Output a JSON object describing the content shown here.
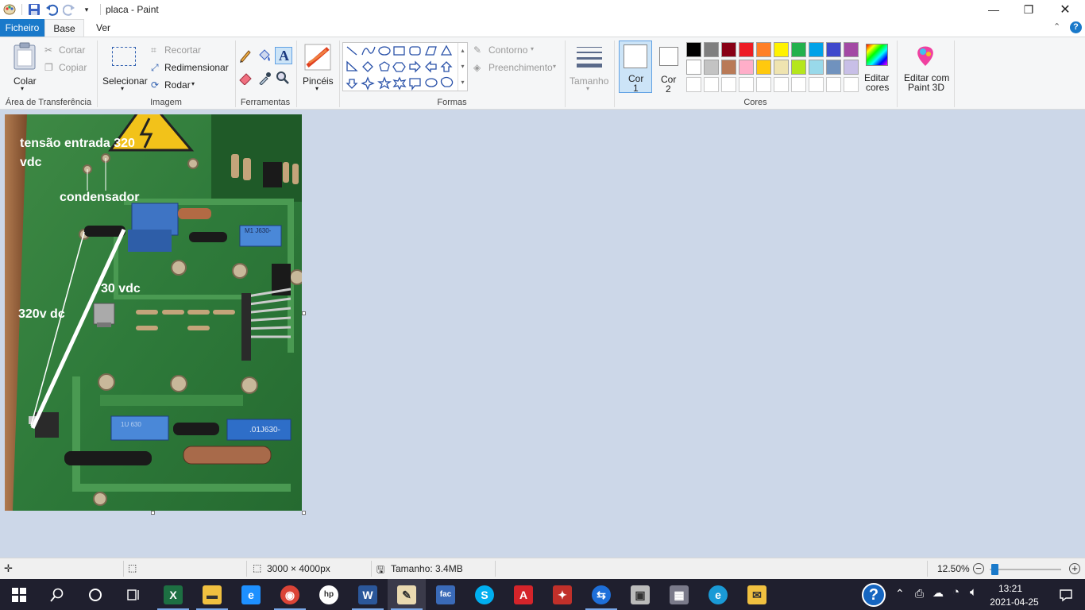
{
  "window": {
    "title": "placa - Paint",
    "controls": [
      "minimize-icon",
      "maximize-icon",
      "close-icon"
    ]
  },
  "tabs": {
    "file": "Ficheiro",
    "home": "Base",
    "view": "Ver"
  },
  "ribbon": {
    "clipboard": {
      "paste": "Colar",
      "cut": "Cortar",
      "copy": "Copiar",
      "group": "Área de Transferência"
    },
    "image": {
      "select": "Selecionar",
      "crop": "Recortar",
      "resize": "Redimensionar",
      "rotate": "Rodar",
      "group": "Imagem"
    },
    "tools": {
      "group": "Ferramentas"
    },
    "brushes": {
      "label": "Pincéis"
    },
    "shapes": {
      "outline": "Contorno",
      "fill": "Preenchimento",
      "group": "Formas"
    },
    "size": {
      "label": "Tamanho"
    },
    "color1": {
      "line1": "Cor",
      "line2": "1"
    },
    "color2": {
      "line1": "Cor",
      "line2": "2"
    },
    "colors": {
      "group": "Cores",
      "edit_line1": "Editar",
      "edit_line2": "cores"
    },
    "paint3d": {
      "line1": "Editar com",
      "line2": "Paint 3D"
    },
    "palette_row1": [
      "#000000",
      "#7f7f7f",
      "#880015",
      "#ed1c24",
      "#ff7f27",
      "#fff200",
      "#22b14c",
      "#00a2e8",
      "#3f48cc",
      "#a349a4"
    ],
    "palette_row2": [
      "#ffffff",
      "#c3c3c3",
      "#b97a57",
      "#ffaec9",
      "#ffc90e",
      "#efe4b0",
      "#b5e61d",
      "#99d9ea",
      "#7092be",
      "#c8bfe7"
    ]
  },
  "canvas": {
    "annotations": {
      "input_voltage_l1": "tensão entrada 320",
      "input_voltage_l2": "vdc",
      "capacitor": "condensador",
      "out_30": "30 vdc",
      "out_320": "320v dc"
    },
    "component_labels": {
      "cap_top": "M1 J630-",
      "cap_bottom": ".01J630-",
      "cap_left": "1U 630"
    }
  },
  "status": {
    "dimensions": "3000 × 4000px",
    "size": "Tamanho: 3.4MB",
    "zoom": "12.50%",
    "zoom_fraction": 0.02
  },
  "taskbar": {
    "time": "13:21",
    "date": "2021-04-25",
    "apps": [
      "excel-icon",
      "file-explorer-icon",
      "internet-explorer-icon",
      "chrome-icon",
      "hp-icon",
      "word-icon",
      "paint-icon",
      "fac-icon",
      "skype-icon",
      "acrobat-icon",
      "game-icon",
      "teamviewer-icon",
      "store-icon",
      "calculator-icon",
      "edge-icon",
      "folder-icon"
    ]
  }
}
